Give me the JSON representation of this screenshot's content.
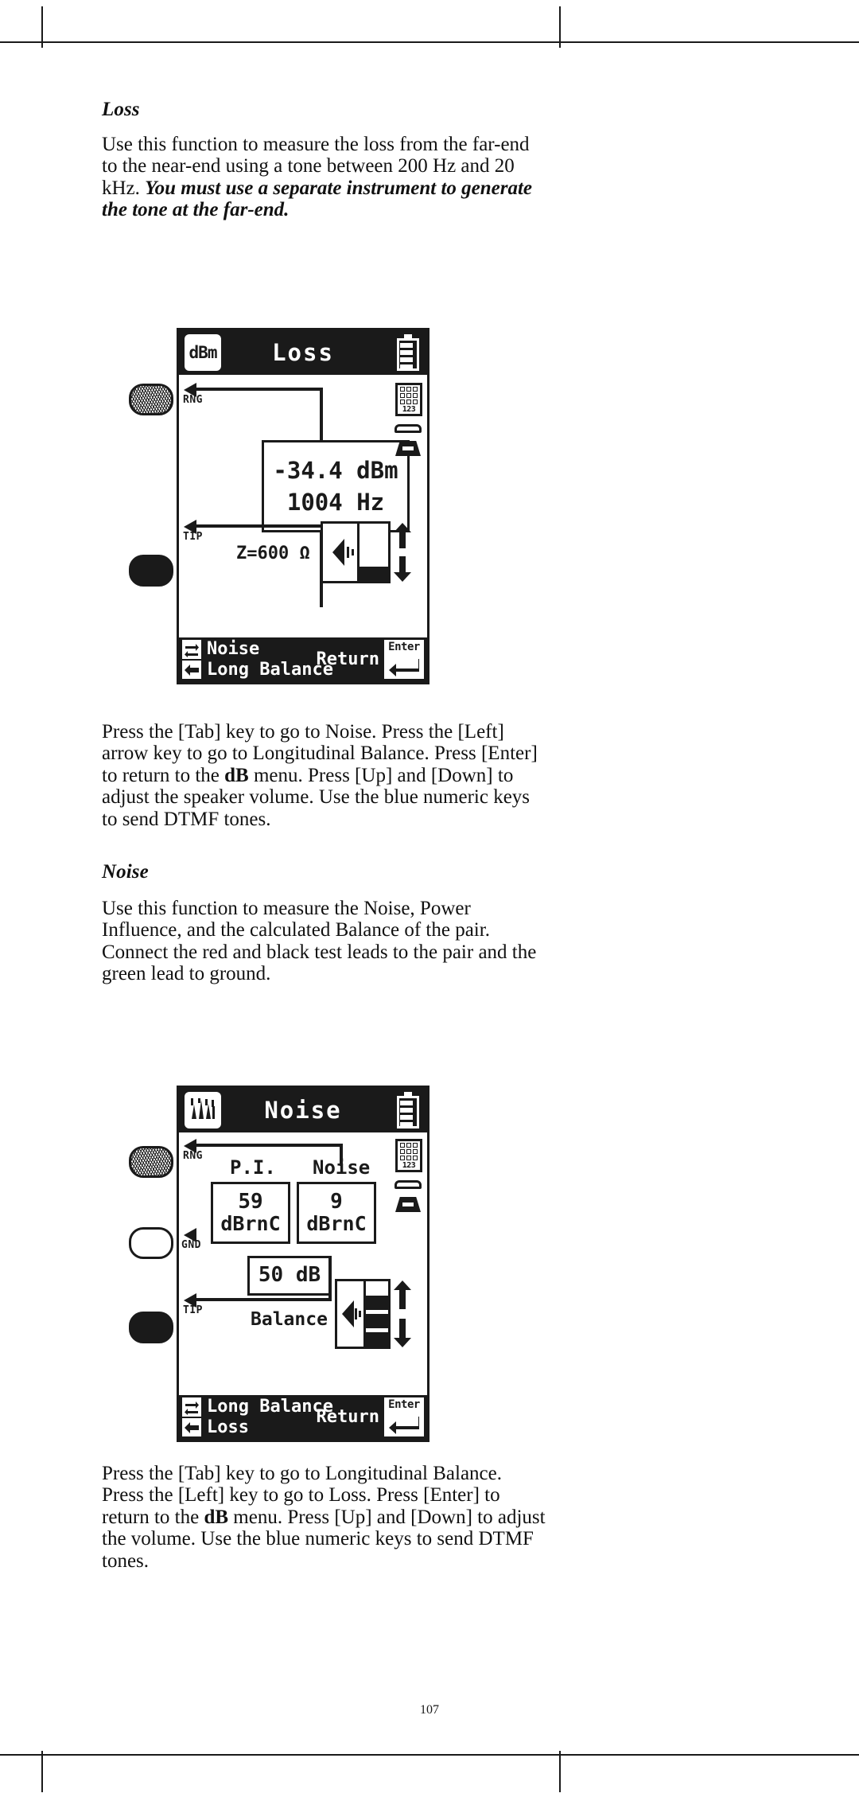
{
  "page": {
    "number": "107"
  },
  "sections": [
    {
      "heading": "Loss",
      "intro_plain_1": "Use this function to measure the loss from the far-end to the near-end using a tone between 200 Hz and 20 kHz. ",
      "intro_bold_italic": "You must use a separate  instrument to generate the tone at the far-end.",
      "outro": "Press the [Tab] key to go to Noise.  Press the [Left] arrow key to go to Longitudinal Balance.  Press [Enter] to return to the ",
      "outro_bold": "dB",
      "outro_2": " menu.  Press [Up] and [Down] to adjust the speaker volume.  Use the blue numeric keys to send DTMF tones."
    },
    {
      "heading": "Noise",
      "intro_plain_1": "Use this function to measure the Noise, Power Influence, and the calculated Balance of the pair. Connect the red and black test leads to the pair and the green lead to ground.",
      "outro": "Press the [Tab] key to go to Longitudinal Balance. Press the [Left] key to go to Loss. Press [Enter] to return to the ",
      "outro_bold": "dB",
      "outro_2": " menu. Press [Up] and [Down] to adjust the volume.  Use the blue numeric keys to send DTMF tones."
    }
  ],
  "device_loss": {
    "mode_badge": "dBm",
    "title": "Loss",
    "battery_icon": "battery-full-icon",
    "buttons": [
      {
        "name": "ring-jack",
        "label": "RNG"
      },
      {
        "name": "tip-jack",
        "label": "TIP"
      }
    ],
    "port_labels": {
      "top": "RNG",
      "bottom": "TIP"
    },
    "reading_primary": "-34.4 dBm",
    "reading_secondary": "1004 Hz",
    "impedance": "Z=600 Ω",
    "icons": {
      "keypad": "keypad-icon",
      "keypad_digits": "123",
      "phone": "telephone-icon",
      "speaker": "speaker-icon"
    },
    "volume_level": 1,
    "footer": {
      "tab_label": "Noise",
      "left_label": "Long Balance",
      "return_label": "Return",
      "enter_label": "Enter"
    }
  },
  "device_noise": {
    "mode_badge": "noise-waveform-icon",
    "title": "Noise",
    "battery_icon": "battery-full-icon",
    "port_labels": {
      "top": "RNG",
      "middle": "GND",
      "bottom": "TIP"
    },
    "col_labels": {
      "left": "P.I.",
      "right": "Noise"
    },
    "pi_value": "59",
    "pi_unit": "dBrnC",
    "noise_value": "9",
    "noise_unit": "dBrnC",
    "balance_value": "50 dB",
    "balance_label": "Balance",
    "icons": {
      "keypad": "keypad-icon",
      "keypad_digits": "123",
      "phone": "telephone-icon",
      "speaker": "speaker-icon"
    },
    "volume_level": 3,
    "footer": {
      "tab_label": "Long Balance",
      "left_label": "Loss",
      "return_label": "Return",
      "enter_label": "Enter"
    }
  }
}
